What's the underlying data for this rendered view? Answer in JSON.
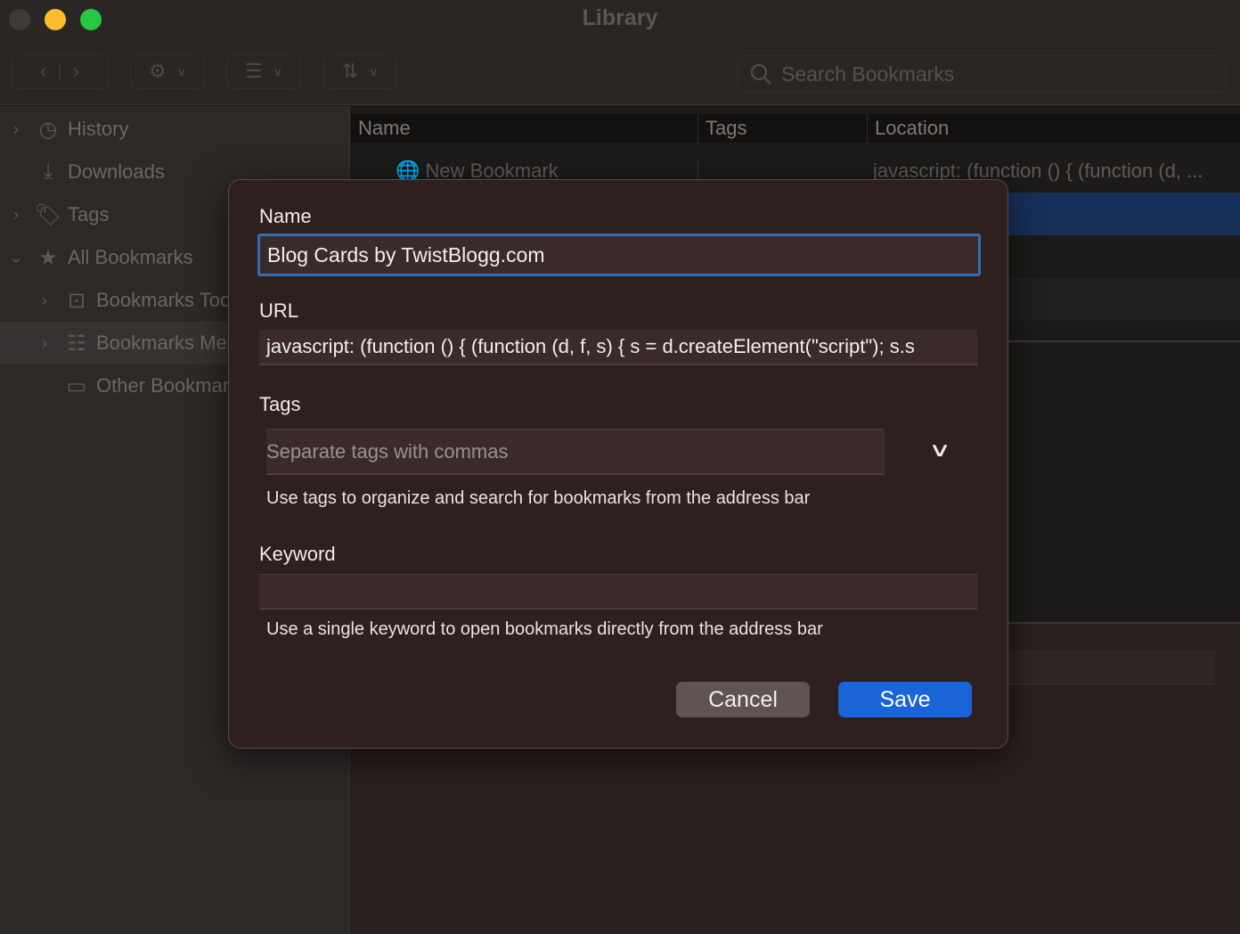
{
  "window": {
    "title": "Library"
  },
  "toolbar": {
    "search_placeholder": "Search Bookmarks"
  },
  "sidebar": {
    "items": [
      {
        "label": "History",
        "icon": "clock-icon"
      },
      {
        "label": "Downloads",
        "icon": "download-icon"
      },
      {
        "label": "Tags",
        "icon": "tag-icon"
      },
      {
        "label": "All Bookmarks",
        "icon": "star-icon"
      },
      {
        "label": "Bookmarks Toolbar",
        "icon": "star-box-icon"
      },
      {
        "label": "Bookmarks Menu",
        "icon": "list-icon"
      },
      {
        "label": "Other Bookmarks",
        "icon": "folder-icon"
      }
    ]
  },
  "table": {
    "columns": [
      "Name",
      "Tags",
      "Location"
    ],
    "rows": [
      {
        "name": "New Bookmark",
        "tags": "",
        "location": "javascript: (function () { (function (d, ..."
      }
    ]
  },
  "dialog": {
    "name_label": "Name",
    "name_value": "Blog Cards by TwistBlogg.com",
    "url_label": "URL",
    "url_value": "javascript: (function () { (function (d, f, s) { s = d.createElement(\"script\"); s.s",
    "tags_label": "Tags",
    "tags_placeholder": "Separate tags with commas",
    "tags_hint": "Use tags to organize and search for bookmarks from the address bar",
    "keyword_label": "Keyword",
    "keyword_value": "",
    "keyword_hint": "Use a single keyword to open bookmarks directly from the address bar",
    "cancel": "Cancel",
    "save": "Save"
  },
  "colors": {
    "accent": "#1a64d8",
    "selection": "#17305a"
  }
}
